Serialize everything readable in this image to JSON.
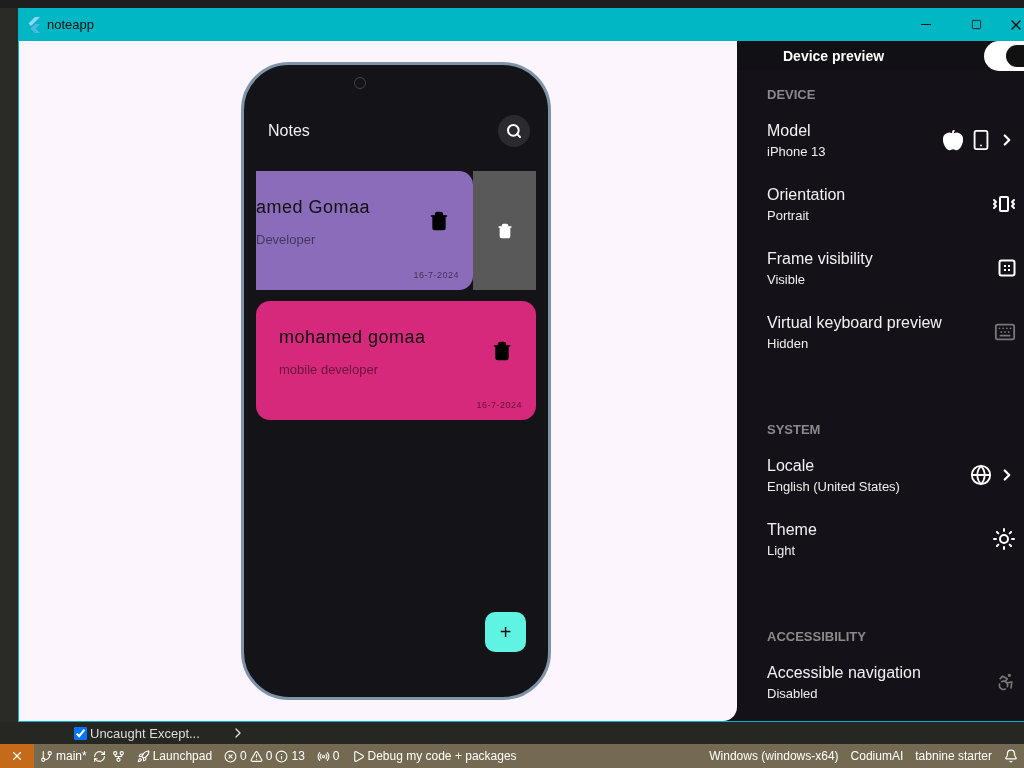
{
  "window": {
    "title": "noteapp"
  },
  "app": {
    "title": "Notes",
    "notes": [
      {
        "kind": "swiped",
        "title": "amed Gomaa",
        "subtitle": "Developer",
        "date": "16-7-2024",
        "color": "#8a6cba"
      },
      {
        "kind": "normal",
        "title": "mohamed gomaa",
        "subtitle": "mobile developer",
        "date": "16-7-2024",
        "color": "#d6297b"
      }
    ],
    "fab": "+"
  },
  "device_preview": {
    "title": "Device preview",
    "on": true,
    "sections": [
      {
        "heading": "DEVICE",
        "items": [
          {
            "label": "Model",
            "value": "iPhone 13",
            "chevron": true
          },
          {
            "label": "Orientation",
            "value": "Portrait",
            "chevron": false
          },
          {
            "label": "Frame visibility",
            "value": "Visible",
            "chevron": false
          },
          {
            "label": "Virtual keyboard preview",
            "value": "Hidden",
            "chevron": false
          }
        ]
      },
      {
        "heading": "SYSTEM",
        "items": [
          {
            "label": "Locale",
            "value": "English (United States)",
            "chevron": true
          },
          {
            "label": "Theme",
            "value": "Light",
            "chevron": false
          }
        ]
      },
      {
        "heading": "ACCESSIBILITY",
        "items": [
          {
            "label": "Accessible navigation",
            "value": "Disabled",
            "chevron": false
          }
        ]
      }
    ]
  },
  "panel_bar": {
    "breakpoint": {
      "label": "Uncaught Except...",
      "checked": true
    }
  },
  "status_bar": {
    "branch": "main*",
    "launchpad": "Launchpad",
    "errors": "0",
    "warnings": "0",
    "infos": "13",
    "ports": "0",
    "debug": "Debug my code + packages",
    "platform": "Windows (windows-x64)",
    "codium": "CodiumAI",
    "tabnine": "tabnine starter"
  }
}
